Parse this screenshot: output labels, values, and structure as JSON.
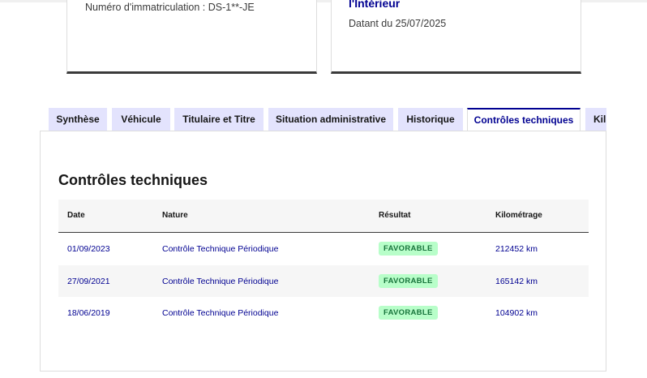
{
  "cards": {
    "left": {
      "registration": "Numéro d'immatriculation : DS-1**-JE"
    },
    "right": {
      "title": "l'Intérieur",
      "dated": "Datant du 25/07/2025"
    }
  },
  "tabs": [
    {
      "label": "Synthèse",
      "active": false
    },
    {
      "label": "Véhicule",
      "active": false
    },
    {
      "label": "Titulaire et Titre",
      "active": false
    },
    {
      "label": "Situation administrative",
      "active": false
    },
    {
      "label": "Historique",
      "active": false
    },
    {
      "label": "Contrôles techniques",
      "active": true
    },
    {
      "label": "Kil",
      "active": false
    }
  ],
  "section": {
    "title": "Contrôles techniques"
  },
  "table": {
    "headers": {
      "date": "Date",
      "nature": "Nature",
      "result": "Résultat",
      "km": "Kilométrage"
    },
    "rows": [
      {
        "date": "01/09/2023",
        "nature": "Contrôle Technique Périodique",
        "result": "FAVORABLE",
        "km": "212452 km"
      },
      {
        "date": "27/09/2021",
        "nature": "Contrôle Technique Périodique",
        "result": "FAVORABLE",
        "km": "165142 km"
      },
      {
        "date": "18/06/2019",
        "nature": "Contrôle Technique Périodique",
        "result": "FAVORABLE",
        "km": "104902 km"
      }
    ]
  },
  "colors": {
    "accent": "#000091",
    "tab_bg": "#e3e3fd",
    "success_bg": "#b8fec9",
    "success_text": "#18753c"
  }
}
